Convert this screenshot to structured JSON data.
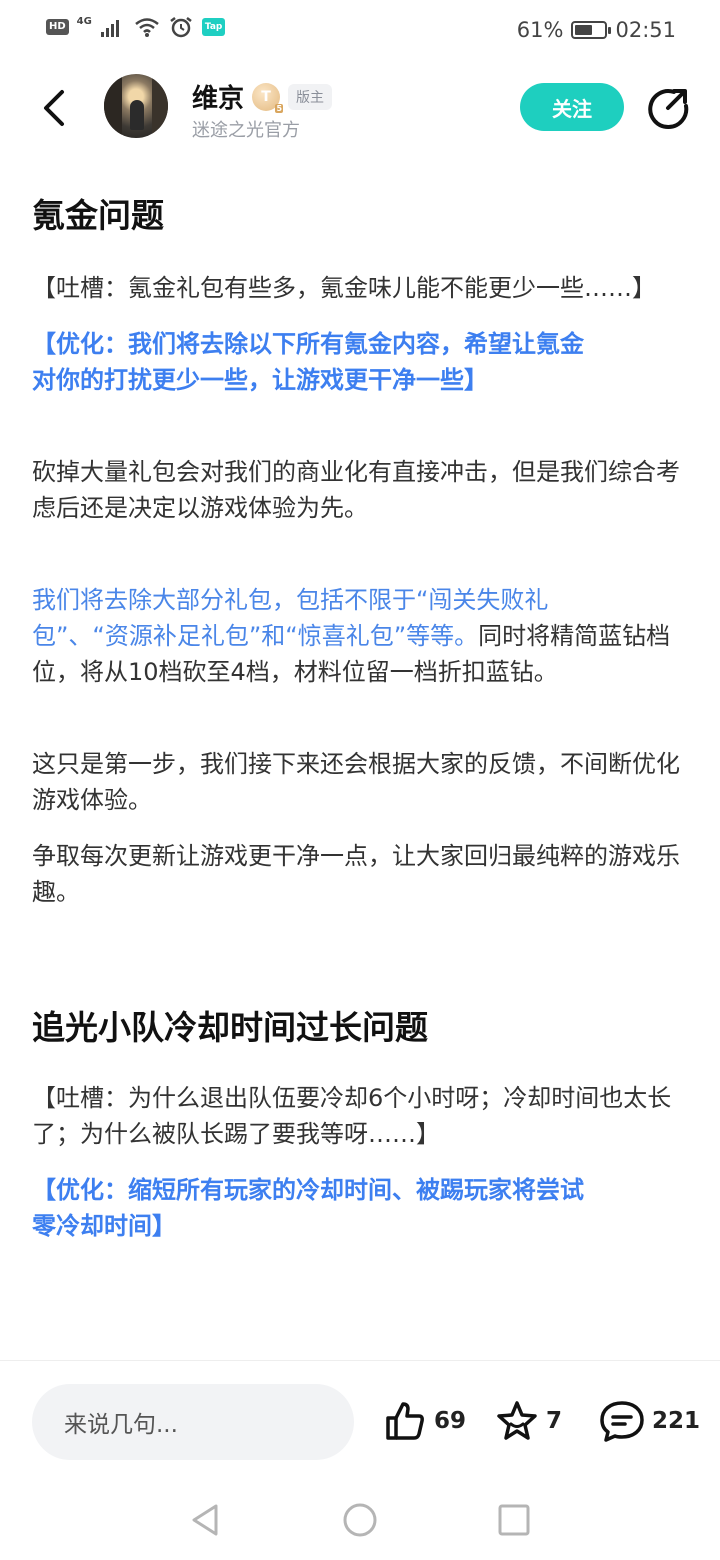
{
  "status_bar": {
    "hd": "HD",
    "network": "4G",
    "tap": "Tap",
    "battery_text": "61%",
    "battery_level": 0.61,
    "time": "02:51"
  },
  "header": {
    "back_icon": "chevron-left-icon",
    "username": "维京",
    "level_badge": "T",
    "level_sub": "5",
    "role": "版主",
    "subtitle": "迷途之光官方",
    "follow_label": "关注",
    "share_icon": "share-icon"
  },
  "article": {
    "section1_title": "氪金问题",
    "s1_complaint": "【吐槽：氪金礼包有些多，氪金味儿能不能更少一些……】",
    "s1_opt_line1": "【优化：我们将去除以下所有氪金内容，希望让氪金",
    "s1_opt_line2": "对你的打扰更少一些，让游戏更干净一些】",
    "s1_para1": "砍掉大量礼包会对我们的商业化有直接冲击，但是我们综合考虑后还是决定以游戏体验为先。",
    "s1_para2_blue_line1": "我们将去除大部分礼包，包括不限于“闯关失败礼",
    "s1_para2_blue_line2": "包”、“资源补足礼包”和“惊喜礼包”等等。",
    "s1_para2_rest": "同时将精简蓝钻档位，将从10档砍至4档，材料位留一档折扣蓝钻。",
    "s1_para3": "这只是第一步，我们接下来还会根据大家的反馈，不间断优化游戏体验。",
    "s1_para4": "争取每次更新让游戏更干净一点，让大家回归最纯粹的游戏乐趣。",
    "section2_title": "追光小队冷却时间过长问题",
    "s2_complaint": "【吐槽：为什么退出队伍要冷却6个小时呀；冷却时间也太长了；为什么被队长踢了要我等呀……】",
    "s2_opt_line1": "【优化：缩短所有玩家的冷却时间、被踢玩家将尝试",
    "s2_opt_line2": "零冷却时间】"
  },
  "bottom_bar": {
    "comment_placeholder": "来说几句...",
    "like_count": "69",
    "favorite_count": "7",
    "comment_count": "221"
  },
  "colors": {
    "accent": "#1ecfbf",
    "link_blue": "#4a86e8"
  }
}
